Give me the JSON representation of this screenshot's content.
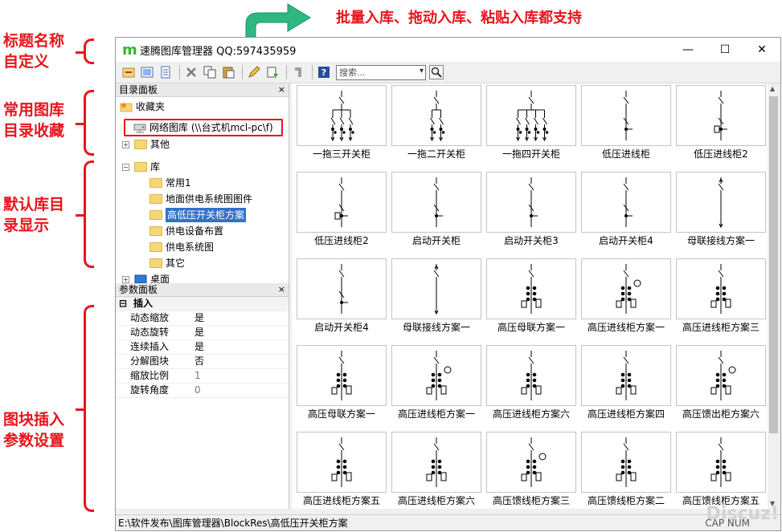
{
  "annotations": {
    "top": "批量入库、拖动入库、粘贴入库都支持",
    "title_custom": [
      "标题名称",
      "自定义"
    ],
    "favorites": [
      "常用图库",
      "目录收藏"
    ],
    "default_lib": [
      "默认库目",
      "录显示"
    ],
    "params": [
      "图块插入",
      "参数设置"
    ]
  },
  "window": {
    "logo": "m",
    "title": "速腾图库管理器 QQ:597435959",
    "minimize": "—",
    "maximize": "☐",
    "close": "✕"
  },
  "toolbar": {
    "search_placeholder": "搜索...",
    "search_dropdown": "▾"
  },
  "catalog_panel": {
    "title": "目录面板",
    "close": "×",
    "favorites": "收藏夹",
    "net_lib": "网络图库 (\\\\台式机mcl-pc\\f)",
    "other": "其他",
    "lib": "库",
    "items": [
      "常用1",
      "地面供电系统图图件",
      "高低压开关柜方案",
      "供电设备布置",
      "供电系统图",
      "其它"
    ],
    "desktop": "桌面",
    "expand_plus": "+",
    "expand_minus": "−"
  },
  "param_panel": {
    "title": "参数面板",
    "close": "×",
    "group": "插入",
    "group_toggle": "⊟",
    "rows": [
      {
        "k": "动态缩放",
        "v": "是"
      },
      {
        "k": "动态旋转",
        "v": "是"
      },
      {
        "k": "连续插入",
        "v": "是"
      },
      {
        "k": "分解图块",
        "v": "否"
      },
      {
        "k": "缩放比例",
        "v": "1"
      },
      {
        "k": "旋转角度",
        "v": "0"
      }
    ]
  },
  "blocks": [
    "一拖三开关柜",
    "一拖二开关柜",
    "一拖四开关柜",
    "低压进线柜",
    "低压进线柜2",
    "低压进线柜2",
    "启动开关柜",
    "启动开关柜3",
    "启动开关柜4",
    "母联接线方案一",
    "启动开关柜4",
    "母联接线方案一",
    "高压母联方案一",
    "高压进线柜方案一",
    "高压进线柜方案三",
    "高压母联方案一",
    "高压进线柜方案一",
    "高压进线柜方案六",
    "高压进线柜方案四",
    "高压馈出柜方案六",
    "高压进线柜方案五",
    "高压进线柜方案六",
    "高压馈线柜方案三",
    "高压馈线柜方案二",
    "高压馈线柜方案五"
  ],
  "status": {
    "path": "E:\\软件发布\\图库管理器\\BlockRes\\高低压开关柜方案",
    "caps": "CAP   NUM",
    "watermark": "Discuz!"
  },
  "colors": {
    "annotation": "#e8141b",
    "selection": "#3371c7",
    "arrow": "#2db82d"
  }
}
